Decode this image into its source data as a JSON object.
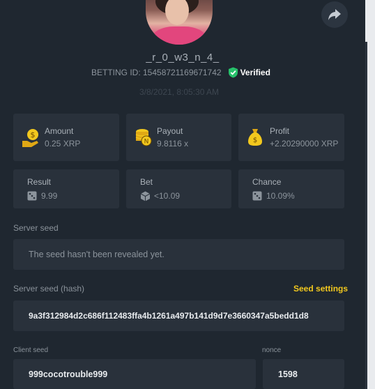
{
  "profile": {
    "username": "_r_0_w3_n_4_",
    "bet_id": "BETTING ID: 15458721169671742",
    "verified_label": "Verified",
    "timestamp": "3/8/2021, 8:05:30 AM"
  },
  "stats": [
    {
      "label": "Amount",
      "value": "0.25 XRP",
      "icon": "money-hand-icon"
    },
    {
      "label": "Payout",
      "value": "9.8116 x",
      "icon": "coin-stack-icon"
    },
    {
      "label": "Profit",
      "value": "+2.20290000 XRP",
      "icon": "money-bag-icon"
    }
  ],
  "results": [
    {
      "label": "Result",
      "value": "9.99",
      "icon": "dice-icon"
    },
    {
      "label": "Bet",
      "value": "<10.09",
      "icon": "cube-icon"
    },
    {
      "label": "Chance",
      "value": "10.09%",
      "icon": "dice-icon"
    }
  ],
  "server_seed": {
    "label": "Server seed",
    "value": "The seed hasn't been revealed yet."
  },
  "server_seed_hash": {
    "label": "Server seed (hash)",
    "link": "Seed settings",
    "value": "9a3f312984d2c686f112483ffa4b1261a497b141d9d7e3660347a5bedd1d8"
  },
  "client_seed": {
    "label": "Client seed",
    "value": "999cocotrouble999"
  },
  "nonce": {
    "label": "nonce",
    "value": "1598"
  },
  "colors": {
    "background": "#1f2730",
    "card": "#29313b",
    "accent": "#f2c81e",
    "verified": "#27c16b"
  }
}
